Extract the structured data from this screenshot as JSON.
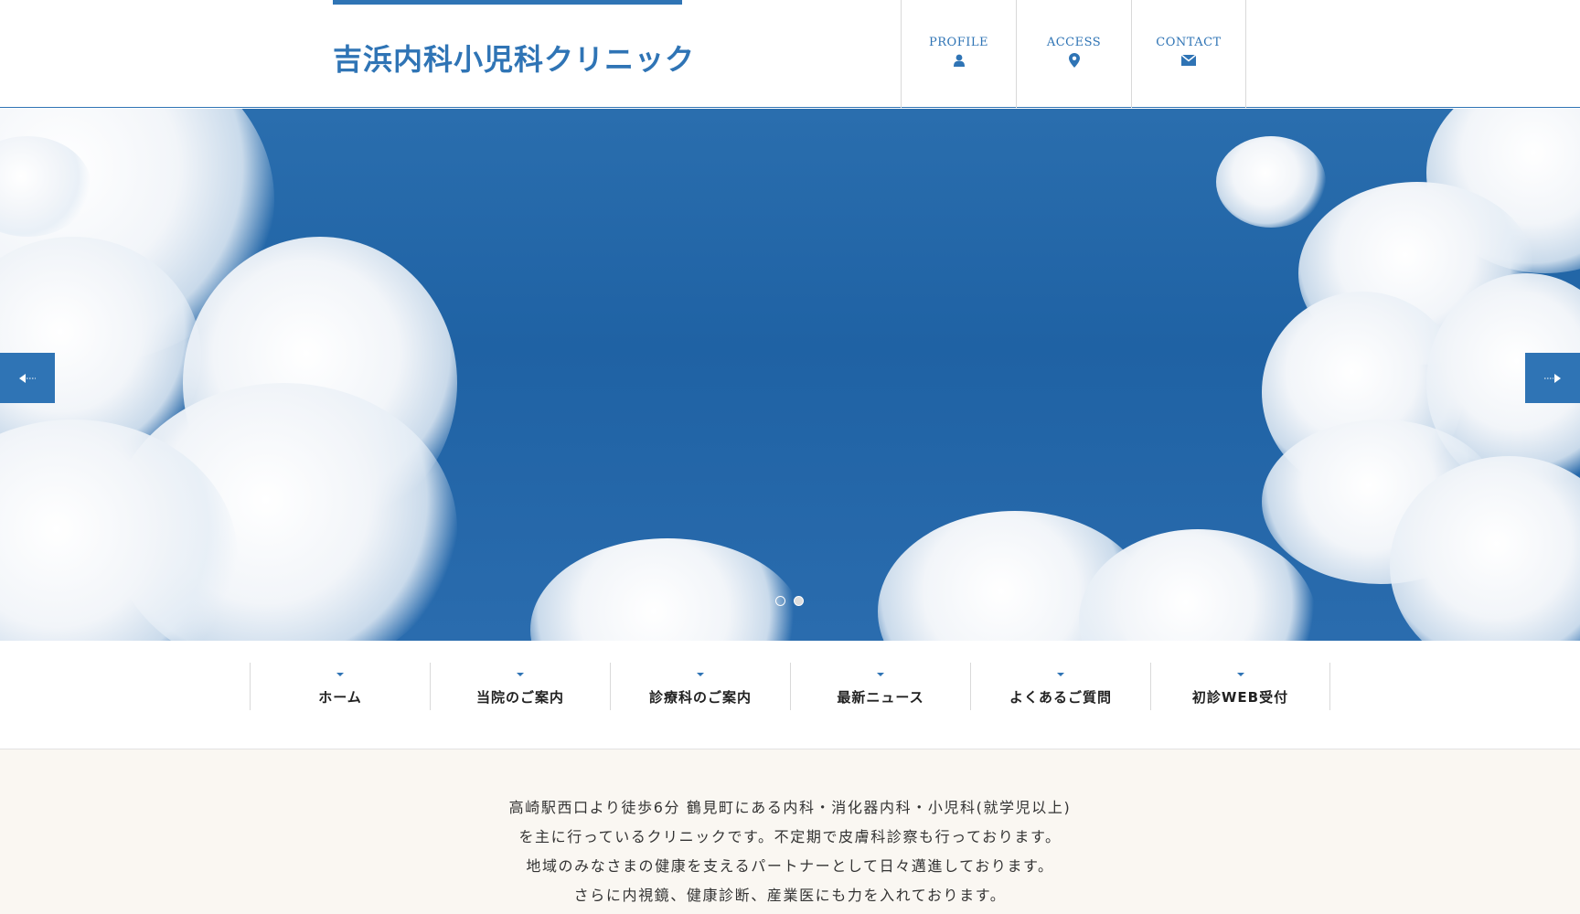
{
  "header": {
    "site_title": "吉浜内科小児科クリニック",
    "nav": [
      {
        "label": "PROFILE",
        "icon": "user-icon"
      },
      {
        "label": "ACCESS",
        "icon": "map-pin-icon"
      },
      {
        "label": "CONTACT",
        "icon": "envelope-icon"
      }
    ]
  },
  "slider": {
    "slide_count": 2,
    "active_slide": 2
  },
  "main_nav": {
    "items": [
      {
        "label": "ホーム"
      },
      {
        "label": "当院のご案内"
      },
      {
        "label": "診療科のご案内"
      },
      {
        "label": "最新ニュース"
      },
      {
        "label": "よくあるご質問"
      },
      {
        "label": "初診WEB受付"
      }
    ]
  },
  "intro": {
    "lines": [
      "高崎駅西口より徒歩6分 鶴見町にある内科・消化器内科・小児科(就学児以上)",
      "を主に行っているクリニックです。不定期で皮膚科診察も行っております。",
      "地域のみなさまの健康を支えるパートナーとして日々邁進しております。",
      "さらに内視鏡、健康診断、産業医にも力を入れております。"
    ]
  },
  "colors": {
    "accent": "#2f74b5",
    "intro_background": "#faf7f2"
  }
}
